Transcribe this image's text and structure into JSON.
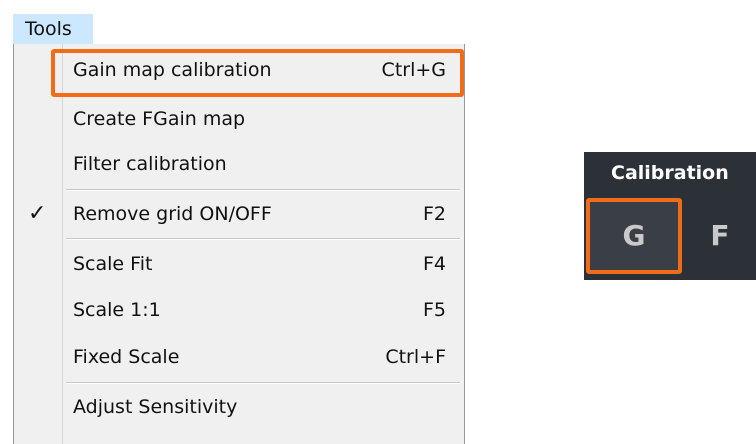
{
  "menubar": {
    "tools_label": "Tools"
  },
  "menu": {
    "items": [
      {
        "label": "Gain map calibration",
        "shortcut": "Ctrl+G",
        "checked": false,
        "highlighted": true
      },
      {
        "label": "Create FGain map",
        "shortcut": "",
        "checked": false
      },
      {
        "label": "Filter calibration",
        "shortcut": "",
        "checked": false
      },
      {
        "label": "Remove grid ON/OFF",
        "shortcut": "F2",
        "checked": true
      },
      {
        "label": "Scale Fit",
        "shortcut": "F4",
        "checked": false
      },
      {
        "label": "Scale 1:1",
        "shortcut": "F5",
        "checked": false
      },
      {
        "label": "Fixed Scale",
        "shortcut": "Ctrl+F",
        "checked": false
      },
      {
        "label": "Adjust Sensitivity",
        "shortcut": "",
        "checked": false
      }
    ],
    "check_glyph": "✓"
  },
  "calibration_toolbar": {
    "title": "Calibration",
    "buttons": [
      {
        "label": "G",
        "highlighted": true
      },
      {
        "label": "F",
        "highlighted": false
      }
    ]
  },
  "colors": {
    "highlight": "#f26b16",
    "menubar_selected": "#cce8ff",
    "toolbar_bg": "#2c3138"
  }
}
